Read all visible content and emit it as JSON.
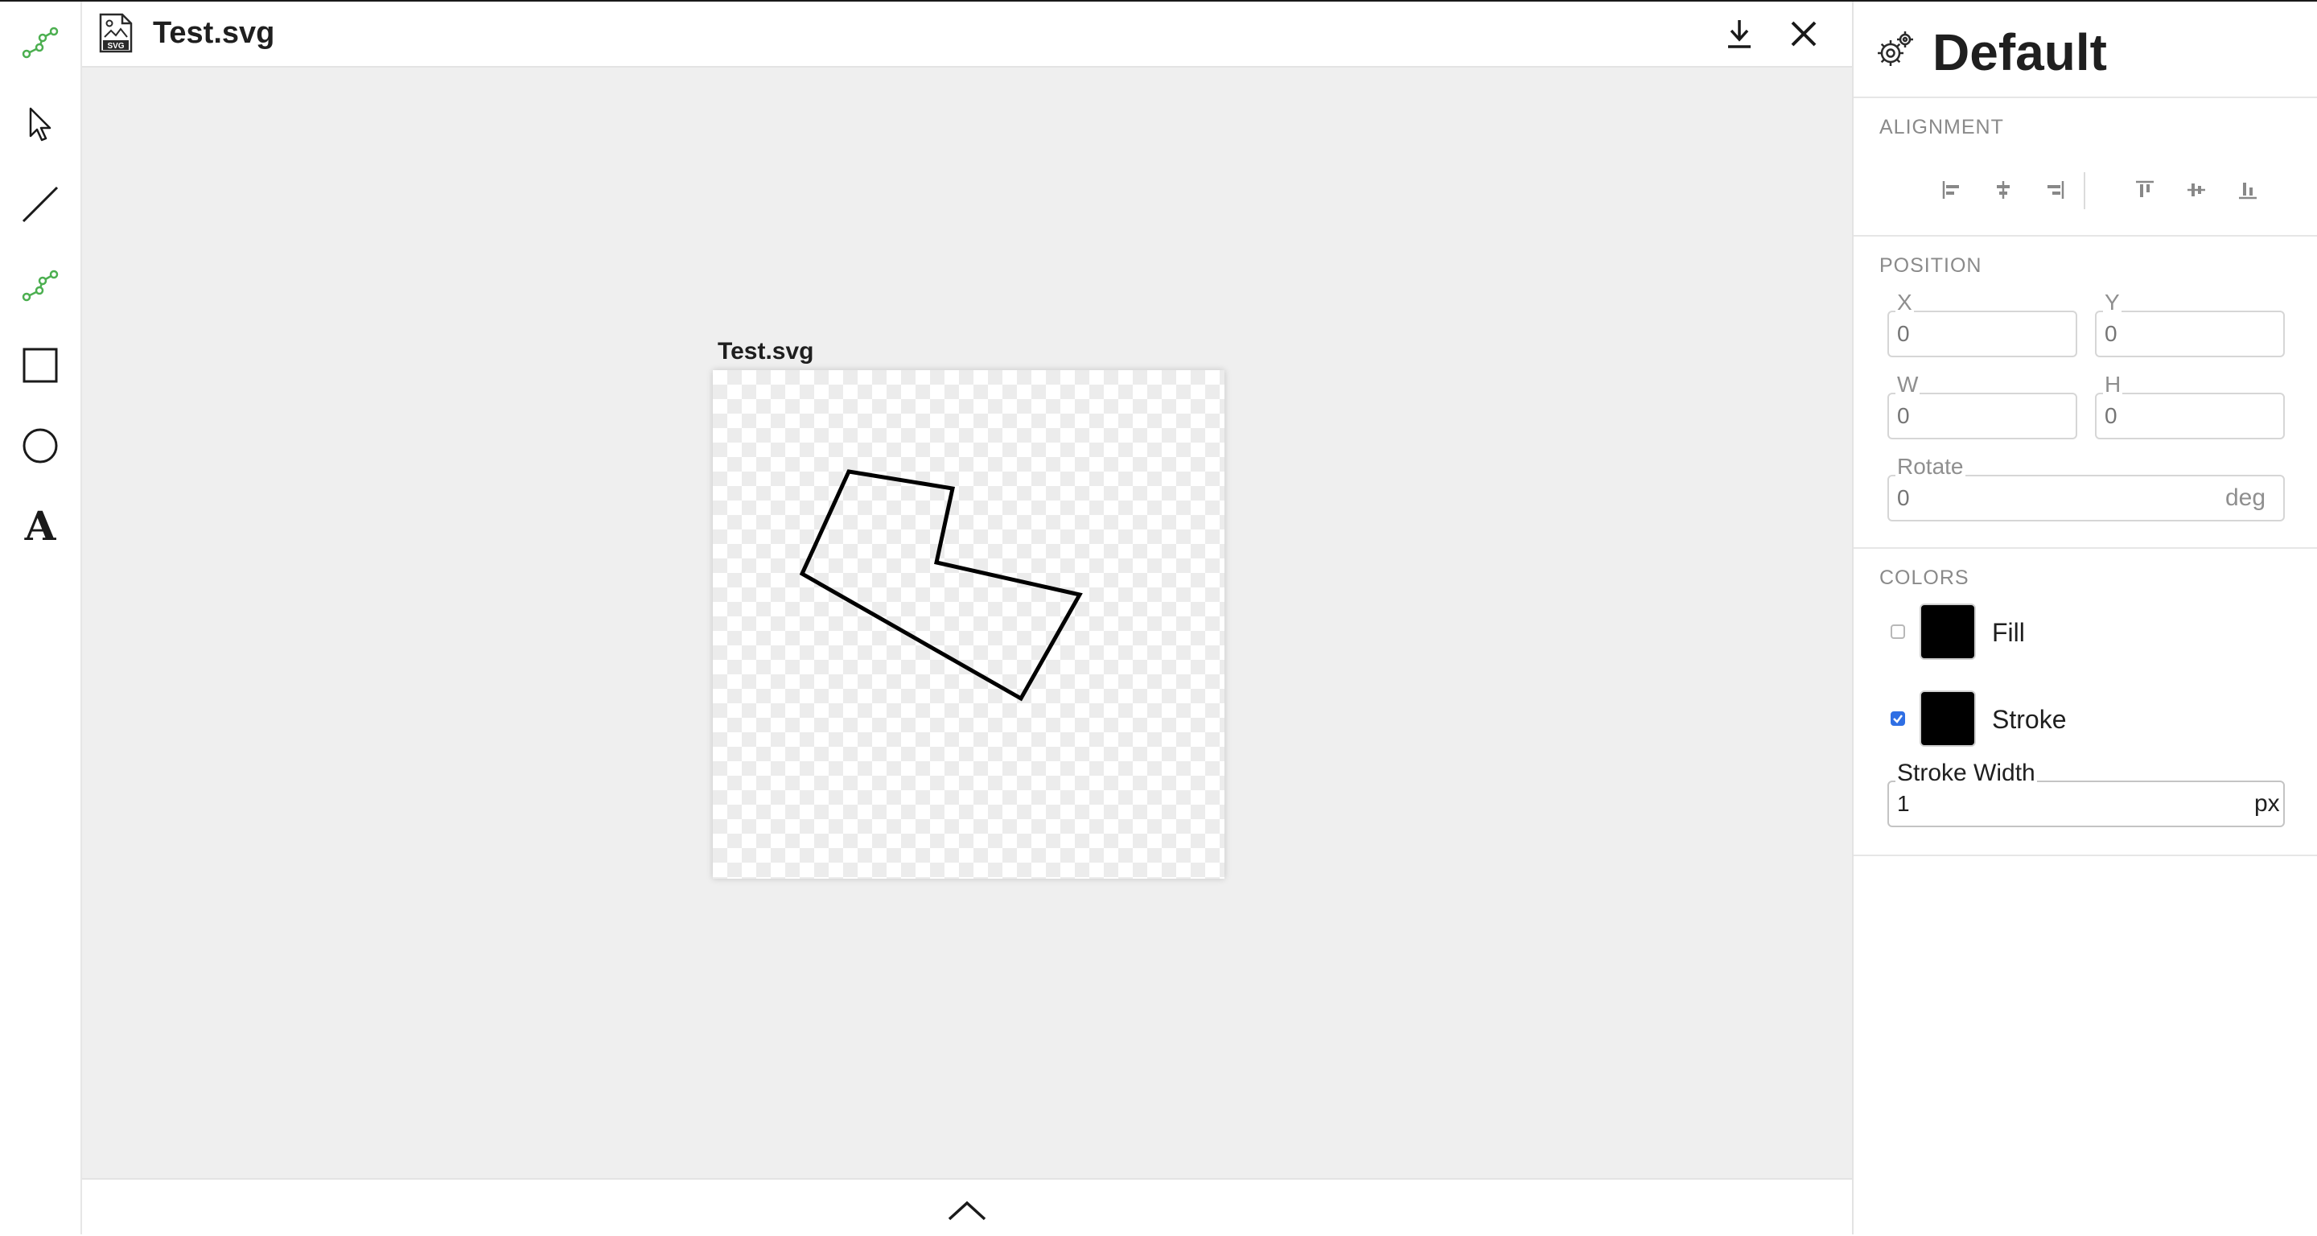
{
  "header": {
    "file_title": "Test.svg",
    "file_icon": "svg-file-icon",
    "download_icon": "download-icon",
    "close_icon": "close-icon"
  },
  "toolbar": {
    "logo_icon": "polyline-logo-icon",
    "tools": [
      {
        "name": "select",
        "icon": "cursor-arrow-icon"
      },
      {
        "name": "line",
        "icon": "line-icon"
      },
      {
        "name": "polyline",
        "icon": "polyline-icon",
        "active": true
      },
      {
        "name": "rectangle",
        "icon": "square-icon"
      },
      {
        "name": "ellipse",
        "icon": "circle-icon"
      },
      {
        "name": "text",
        "icon": "text-a-icon",
        "glyph": "A"
      }
    ],
    "active_color": "#4caf50"
  },
  "canvas": {
    "document_label": "Test.svg",
    "shape": {
      "type": "polygon",
      "stroke": "#000000",
      "fill": "none"
    }
  },
  "bottom": {
    "expand_icon": "chevron-up-icon"
  },
  "panel": {
    "title": "Default",
    "settings_icon": "gear-icon",
    "alignment": {
      "title": "ALIGNMENT",
      "buttons": [
        "align-left-icon",
        "align-center-horizontal-icon",
        "align-right-icon",
        "align-top-icon",
        "align-middle-vertical-icon",
        "align-bottom-icon"
      ]
    },
    "position": {
      "title": "POSITION",
      "x_label": "X",
      "x_placeholder": "0",
      "y_label": "Y",
      "y_placeholder": "0",
      "w_label": "W",
      "w_placeholder": "0",
      "h_label": "H",
      "h_placeholder": "0",
      "rotate_label": "Rotate",
      "rotate_placeholder": "0",
      "rotate_unit": "deg"
    },
    "colors": {
      "title": "COLORS",
      "fill_label": "Fill",
      "fill_enabled": false,
      "fill_color": "#000000",
      "stroke_label": "Stroke",
      "stroke_enabled": true,
      "stroke_color": "#000000",
      "stroke_width_label": "Stroke Width",
      "stroke_width_value": "1",
      "stroke_width_unit": "px"
    }
  }
}
